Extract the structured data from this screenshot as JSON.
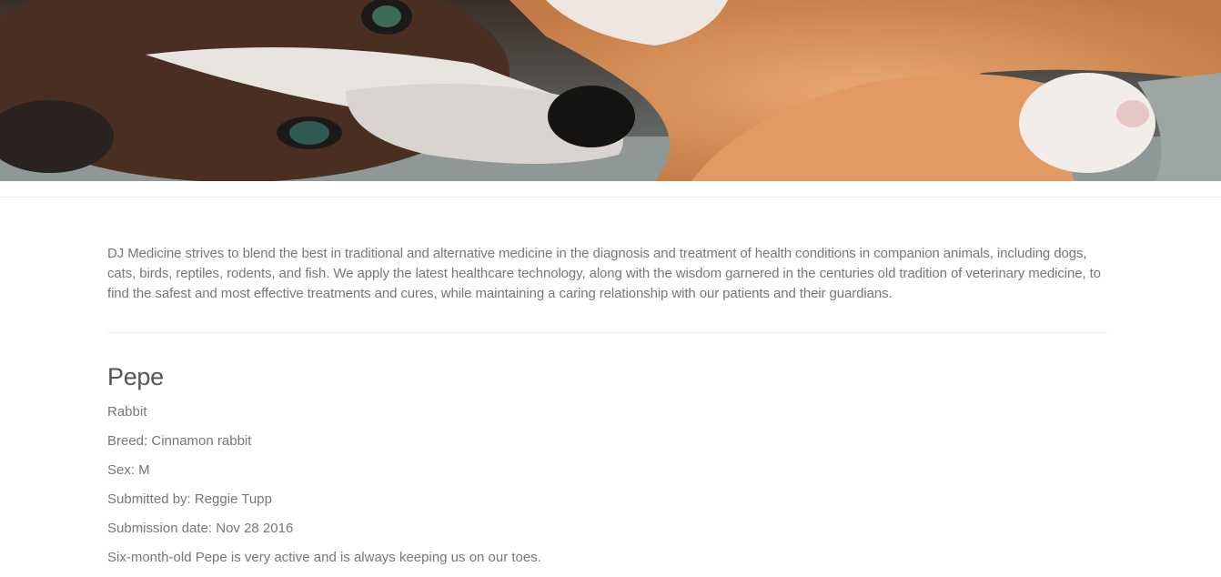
{
  "hero": {
    "image_description_icon": "dog-and-cat-photo"
  },
  "intro": {
    "text": "DJ Medicine strives to blend the best in traditional and alternative medicine in the diagnosis and treatment of health conditions in companion animals, including dogs, cats, birds, reptiles, rodents, and fish. We apply the latest healthcare technology, along with the wisdom garnered in the centuries old tradition of veterinary medicine, to find the safest and most effective treatments and cures, while maintaining a caring relationship with our patients and their guardians."
  },
  "pet": {
    "name": "Pepe",
    "species": "Rabbit",
    "breed": "Breed: Cinnamon rabbit",
    "sex": "Sex: M",
    "submitted_by": "Submitted by: Reggie Tupp",
    "submission_date": "Submission date: Nov 28 2016",
    "description": "Six-month-old Pepe is very active and is always keeping us on our toes."
  },
  "colors": {
    "text": "#777777",
    "heading": "#555555",
    "divider": "#eeeeee"
  }
}
